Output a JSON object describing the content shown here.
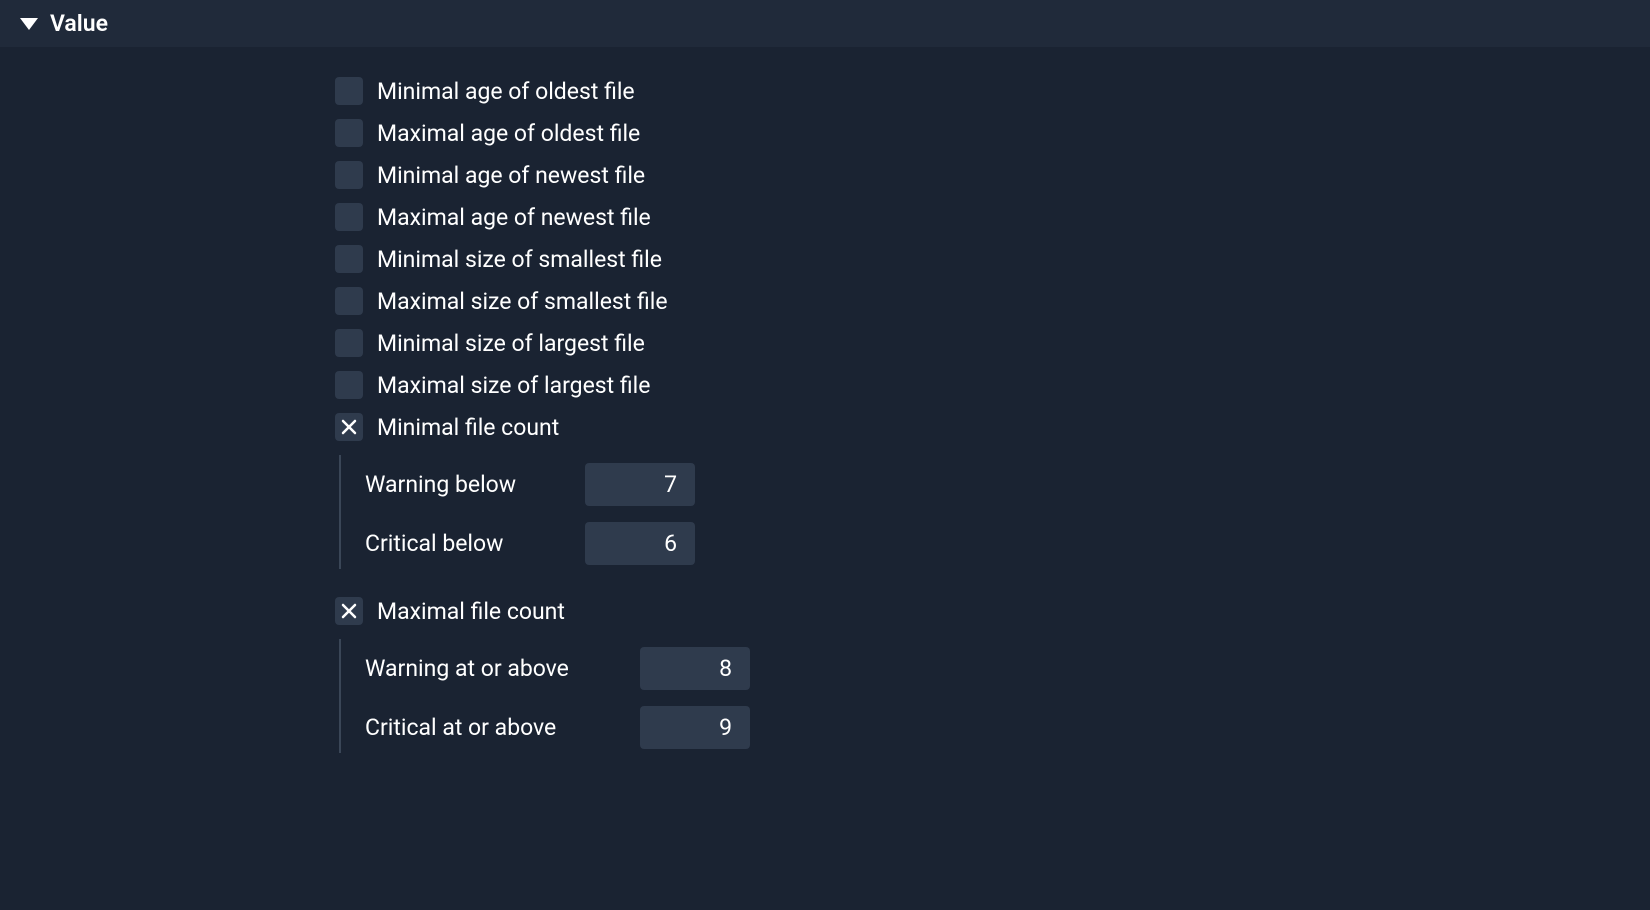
{
  "section": {
    "title": "Value"
  },
  "options": {
    "min_age_oldest": {
      "label": "Minimal age of oldest file",
      "checked": false
    },
    "max_age_oldest": {
      "label": "Maximal age of oldest file",
      "checked": false
    },
    "min_age_newest": {
      "label": "Minimal age of newest file",
      "checked": false
    },
    "max_age_newest": {
      "label": "Maximal age of newest file",
      "checked": false
    },
    "min_size_smallest": {
      "label": "Minimal size of smallest file",
      "checked": false
    },
    "max_size_smallest": {
      "label": "Maximal size of smallest file",
      "checked": false
    },
    "min_size_largest": {
      "label": "Minimal size of largest file",
      "checked": false
    },
    "max_size_largest": {
      "label": "Maximal size of largest file",
      "checked": false
    },
    "min_file_count": {
      "label": "Minimal file count",
      "checked": true,
      "warning_label": "Warning below",
      "warning_value": "7",
      "critical_label": "Critical below",
      "critical_value": "6"
    },
    "max_file_count": {
      "label": "Maximal file count",
      "checked": true,
      "warning_label": "Warning at or above",
      "warning_value": "8",
      "critical_label": "Critical at or above",
      "critical_value": "9"
    }
  }
}
